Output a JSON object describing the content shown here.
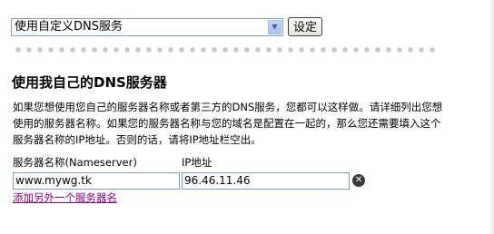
{
  "dns_mode": {
    "selected": "使用自定义DNS服务",
    "set_button": "设定"
  },
  "section": {
    "heading": "使用我自己的DNS服务器",
    "description": "如果您想使用您自己的服务器名称或者第三方的DNS服务，您都可以这样做。请详细列出您想使用的服务器名称。如果您的服务器名称与您的域名是配置在一起的，那么您还需要填入这个服务器名称的IP地址。否则的话，请将IP地址栏空出。"
  },
  "fields": {
    "nameserver_label": "服务器名称(Nameserver)",
    "ip_label": "IP地址",
    "nameserver_value": "www.mywg.tk",
    "ip_value": "96.46.11.46"
  },
  "add_link": "添加另外一个服务器名"
}
